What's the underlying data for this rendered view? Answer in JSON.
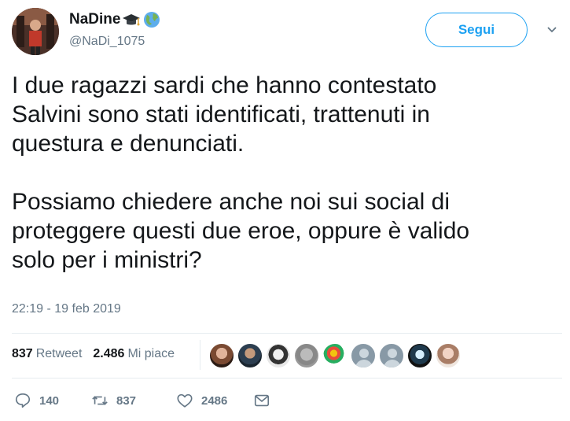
{
  "author": {
    "display_name": "NaDine",
    "handle": "@NaDi_1075",
    "avatar_icon": "profile-photo",
    "name_emojis": [
      "graduation-cap-icon",
      "globe-icon"
    ]
  },
  "follow_button": {
    "label": "Segui",
    "color": "#1da1f2"
  },
  "menu_icon": "chevron-down-icon",
  "tweet": {
    "paragraphs": [
      "I due ragazzi sardi che hanno contestato\nSalvini sono stati identificati, trattenuti in\nquestura e denunciati.",
      "Possiamo chiedere anche noi sui social di\nproteggere questi due eroe, oppure è valido\nsolo per i ministri?"
    ],
    "timestamp": "22:19 - 19 feb 2019"
  },
  "stats": {
    "retweets_count": "837",
    "retweets_label": "Retweet",
    "likes_count": "2.486",
    "likes_label": "Mi piace"
  },
  "likers": [
    "avatar-1",
    "avatar-2",
    "avatar-3",
    "avatar-4",
    "avatar-5",
    "avatar-6",
    "avatar-7",
    "avatar-8",
    "avatar-9"
  ],
  "actions": {
    "reply": {
      "icon": "reply-icon",
      "count": "140"
    },
    "retweet": {
      "icon": "retweet-icon",
      "count": "837"
    },
    "like": {
      "icon": "heart-icon",
      "count": "2486"
    },
    "message": {
      "icon": "envelope-icon"
    }
  },
  "colors": {
    "text": "#14171a",
    "muted": "#657786",
    "accent": "#1da1f2",
    "border": "#e6ecf0"
  }
}
